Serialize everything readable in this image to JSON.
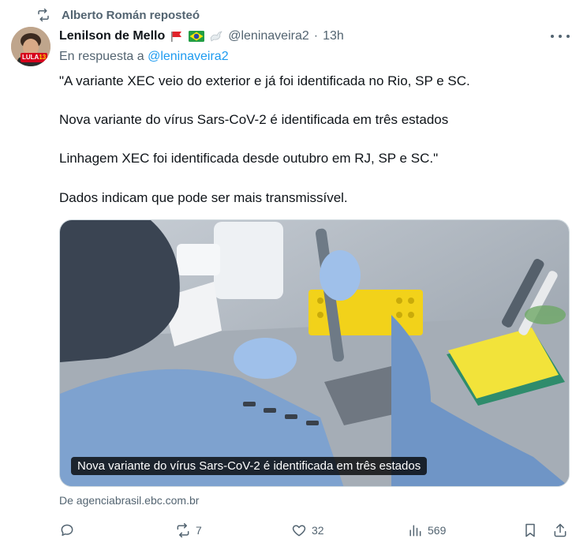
{
  "repost": {
    "label": "Alberto Román reposteó",
    "icon": "repost-icon"
  },
  "tweet": {
    "author_name": "Lenilson de Mello",
    "author_emojis": [
      "red-flag-icon",
      "brazil-flag-icon",
      "dove-icon"
    ],
    "handle": "@leninaveira2",
    "separator": "·",
    "time": "13h",
    "reply_prefix": "En respuesta a",
    "reply_handle": "@leninaveira2",
    "avatar_badge_text": "LULA",
    "avatar_badge_number": "13",
    "text": [
      "\"A variante XEC veio do exterior e já foi identificada no Rio, SP e SC.",
      "Nova variante do vírus Sars-CoV-2 é identificada em três estados",
      "Linhagem XEC foi identificada desde outubro em RJ, SP e SC.\"",
      "Dados indicam que pode ser mais transmissível."
    ],
    "media_caption": "Nova variante do vírus Sars-CoV-2 é identificada em três estados",
    "source": "De agenciabrasil.ebc.com.br"
  },
  "actions": {
    "reply": {
      "icon": "reply-icon",
      "count": ""
    },
    "repost": {
      "icon": "repost-icon",
      "count": "7"
    },
    "like": {
      "icon": "heart-icon",
      "count": "32"
    },
    "views": {
      "icon": "views-icon",
      "count": "569"
    },
    "bookmark": {
      "icon": "bookmark-icon"
    },
    "share": {
      "icon": "share-icon"
    }
  },
  "colors": {
    "link": "#1d9bf0",
    "secondary": "#536471",
    "text": "#0f1419"
  }
}
